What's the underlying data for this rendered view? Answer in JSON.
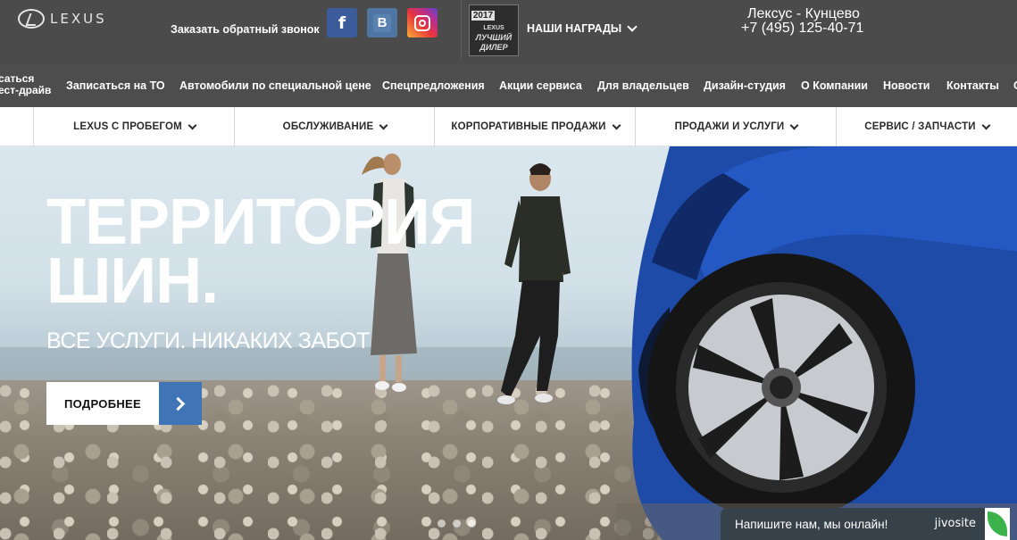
{
  "header": {
    "logo_text": "LEXUS",
    "callback_label": "Заказать обратный звонок",
    "social": {
      "facebook": "f",
      "vk": "B"
    },
    "award_badge": {
      "year": "2017",
      "brand": "LEXUS",
      "line1": "ЛУЧШИЙ",
      "line2": "ДИЛЕР"
    },
    "awards_label": "НАШИ НАГРАДЫ",
    "dealer_name": "Лексус - Кунцево",
    "dealer_phone": "+7 (495) 125-40-71"
  },
  "nav": {
    "left_partial_line1": "саться",
    "left_partial_line2": "ест-драйв",
    "items": [
      "Записаться на ТО",
      "Автомобили по специальной цене",
      "Спецпредложения",
      "Акции сервиса",
      "Для владельцев",
      "Дизайн-студия",
      "О Компании",
      "Новости",
      "Контакты"
    ],
    "right_partial": "С"
  },
  "subnav": {
    "items": [
      "LEXUS С ПРОБЕГОМ",
      "ОБСЛУЖИВАНИЕ",
      "КОРПОРАТИВНЫЕ ПРОДАЖИ",
      "ПРОДАЖИ И УСЛУГИ",
      "СЕРВИС / ЗАПЧАСТИ"
    ]
  },
  "hero": {
    "title_line1": "ТЕРРИТОРИЯ",
    "title_line2": "ШИН.",
    "subtitle": "ВСЕ УСЛУГИ. НИКАКИХ ЗАБОТ",
    "button_label": "ПОДРОБНЕЕ",
    "slide_count": 3
  },
  "chat": {
    "message": "Напишите нам, мы онлайн!",
    "brand": "jivosite"
  },
  "colors": {
    "topbar": "#4b4b4b",
    "accent_blue": "#3f74b7",
    "chat_bg": "#36414a",
    "chat_leaf": "#3bb34a"
  }
}
